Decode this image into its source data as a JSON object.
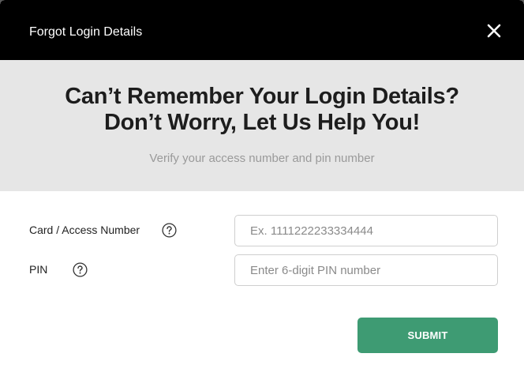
{
  "modal": {
    "title": "Forgot Login Details",
    "close_icon": "close-icon"
  },
  "hero": {
    "title_line1": "Can’t Remember Your Login Details?",
    "title_line2": "Don’t Worry, Let Us Help You!",
    "subtitle": "Verify your access number and pin number"
  },
  "form": {
    "card_label": "Card / Access Number",
    "card_placeholder": "Ex. 1111222233334444",
    "card_value": "",
    "card_help_icon": "question-circle-icon",
    "pin_label": "PIN",
    "pin_placeholder": "Enter 6-digit PIN number",
    "pin_value": "",
    "pin_help_icon": "question-circle-icon",
    "submit_label": "SUBMIT"
  },
  "colors": {
    "header_bg": "#000000",
    "hero_bg": "#e6e6e6",
    "submit_bg": "#3e9b73"
  }
}
